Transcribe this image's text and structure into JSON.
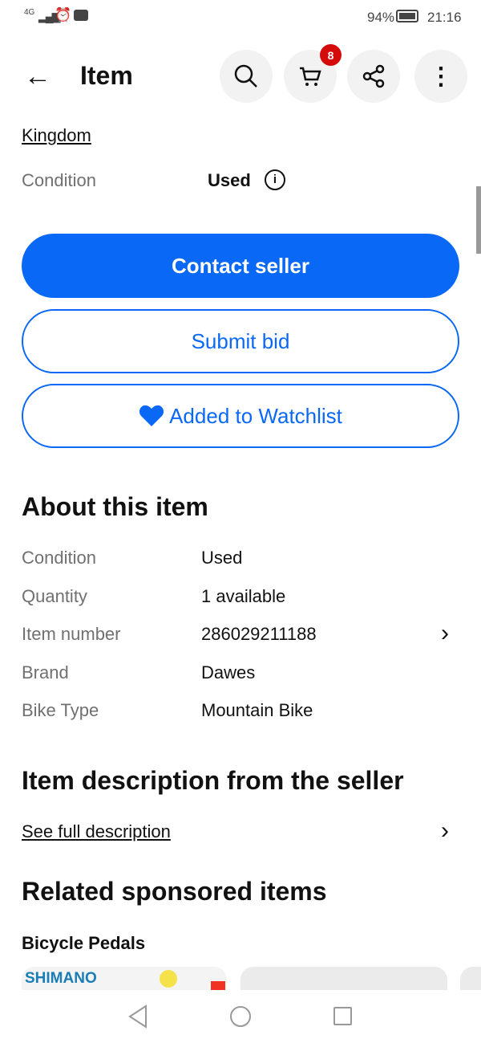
{
  "status_bar": {
    "network": "4G",
    "battery": "94%",
    "time": "21:16"
  },
  "header": {
    "title": "Item",
    "cart_count": "8"
  },
  "location_partial": "Kingdom",
  "condition": {
    "label": "Condition",
    "value": "Used"
  },
  "buttons": {
    "contact": "Contact seller",
    "bid": "Submit bid",
    "watchlist": "Added to Watchlist"
  },
  "about": {
    "title": "About this item",
    "rows": [
      {
        "label": "Condition",
        "value": "Used"
      },
      {
        "label": "Quantity",
        "value": "1 available"
      },
      {
        "label": "Item number",
        "value": "286029211188"
      },
      {
        "label": "Brand",
        "value": "Dawes"
      },
      {
        "label": "Bike Type",
        "value": "Mountain Bike"
      }
    ]
  },
  "description": {
    "title": "Item description from the seller",
    "link": "See full description"
  },
  "related": {
    "title": "Related sponsored items",
    "category": "Bicycle Pedals",
    "brand_logo": "SHIMANO"
  },
  "colors": {
    "accent": "#0968f6",
    "badge": "#d50b0b"
  }
}
